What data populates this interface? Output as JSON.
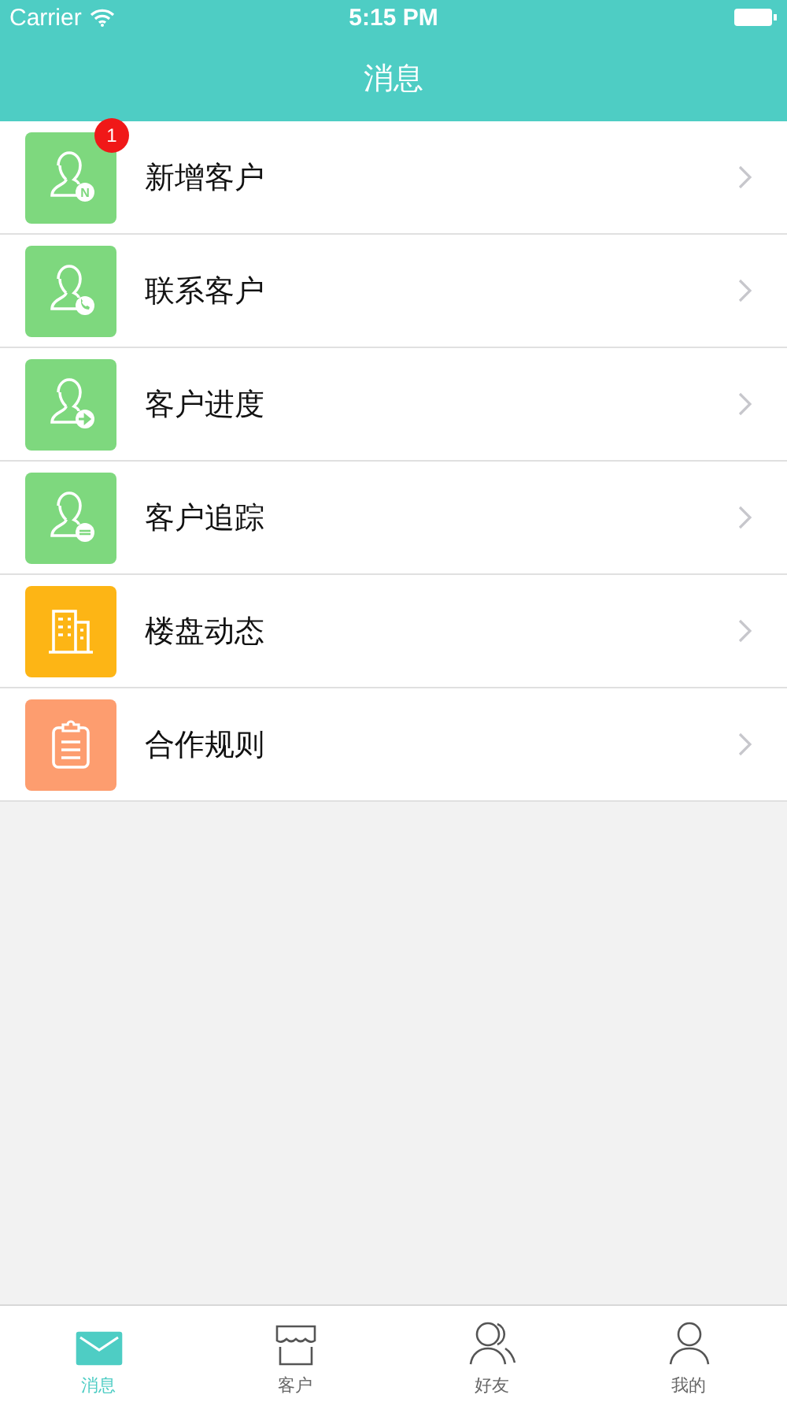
{
  "status_bar": {
    "carrier": "Carrier",
    "time": "5:15 PM"
  },
  "nav": {
    "title": "消息"
  },
  "items": [
    {
      "label": "新增客户",
      "kind": "person-n",
      "icon_letter": "N",
      "color": "#7ed87e",
      "badge": "1"
    },
    {
      "label": "联系客户",
      "kind": "person-phone",
      "color": "#7ed87e"
    },
    {
      "label": "客户进度",
      "kind": "person-arrow",
      "color": "#7ed87e"
    },
    {
      "label": "客户追踪",
      "kind": "person-chat",
      "color": "#7ed87e"
    },
    {
      "label": "楼盘动态",
      "kind": "building",
      "color": "#fdb515"
    },
    {
      "label": "合作规则",
      "kind": "clipboard",
      "color": "#fd9d6f"
    }
  ],
  "tabs": [
    {
      "label": "消息",
      "kind": "mail",
      "selected": true
    },
    {
      "label": "客户",
      "kind": "store",
      "selected": false
    },
    {
      "label": "好友",
      "kind": "friends",
      "selected": false
    },
    {
      "label": "我的",
      "kind": "person",
      "selected": false
    }
  ]
}
